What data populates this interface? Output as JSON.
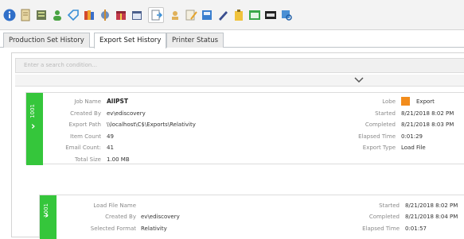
{
  "toolbar": {
    "icons": [
      "info-icon",
      "document-icon",
      "server-icon",
      "user-icon",
      "tag-icon",
      "books-icon",
      "tools-icon",
      "gift-icon",
      "calendar-icon",
      "export-icon",
      "person-search-icon",
      "pencil-note-icon",
      "save-list-icon",
      "edit-pen-icon",
      "clipboard-icon",
      "window-icon",
      "abc-text-icon",
      "grid-search-icon"
    ]
  },
  "tabs": [
    {
      "label": "Production Set History"
    },
    {
      "label": "Export Set History"
    },
    {
      "label": "Printer Status"
    }
  ],
  "active_tab": "Export Set History",
  "search": {
    "placeholder": "Enter a search condition..."
  },
  "export_job": {
    "sidebar_number": "1001",
    "job_name_label": "Job Name",
    "job_name": "AllPST",
    "created_by_label": "Created By",
    "created_by": "ev\\ediscovery",
    "export_path_label": "Export Path",
    "export_path": "\\\\localhost\\C$\\Exports\\Relativity",
    "item_count_label": "Item Count",
    "item_count": "49",
    "email_count_label": "Email Count:",
    "email_count": "41",
    "total_size_label": "Total Size",
    "total_size": "1.00 MB",
    "lobe_label": "Lobe",
    "lobe_color": "#f28c1c",
    "lobe": "Export",
    "started_label": "Started",
    "started": "8/21/2018 8:02 PM",
    "completed_label": "Completed",
    "completed": "8/21/2018 8:03 PM",
    "elapsed_label": "Elapsed Time",
    "elapsed": "0:01:29",
    "export_type_label": "Export Type",
    "export_type": "Load File"
  },
  "load_file": {
    "sidebar_number": "1001",
    "name_label": "Load File Name",
    "name": "",
    "created_by_label": "Created By",
    "created_by": "ev\\ediscovery",
    "format_label": "Selected Format",
    "format": "Relativity",
    "started_label": "Started",
    "started": "8/21/2018 8:02 PM",
    "completed_label": "Completed",
    "completed": "8/21/2018 8:04 PM",
    "elapsed_label": "Elapsed Time",
    "elapsed": "0:01:57"
  },
  "colors": {
    "accent_green": "#35c63b",
    "lobe_orange": "#f28c1c"
  }
}
